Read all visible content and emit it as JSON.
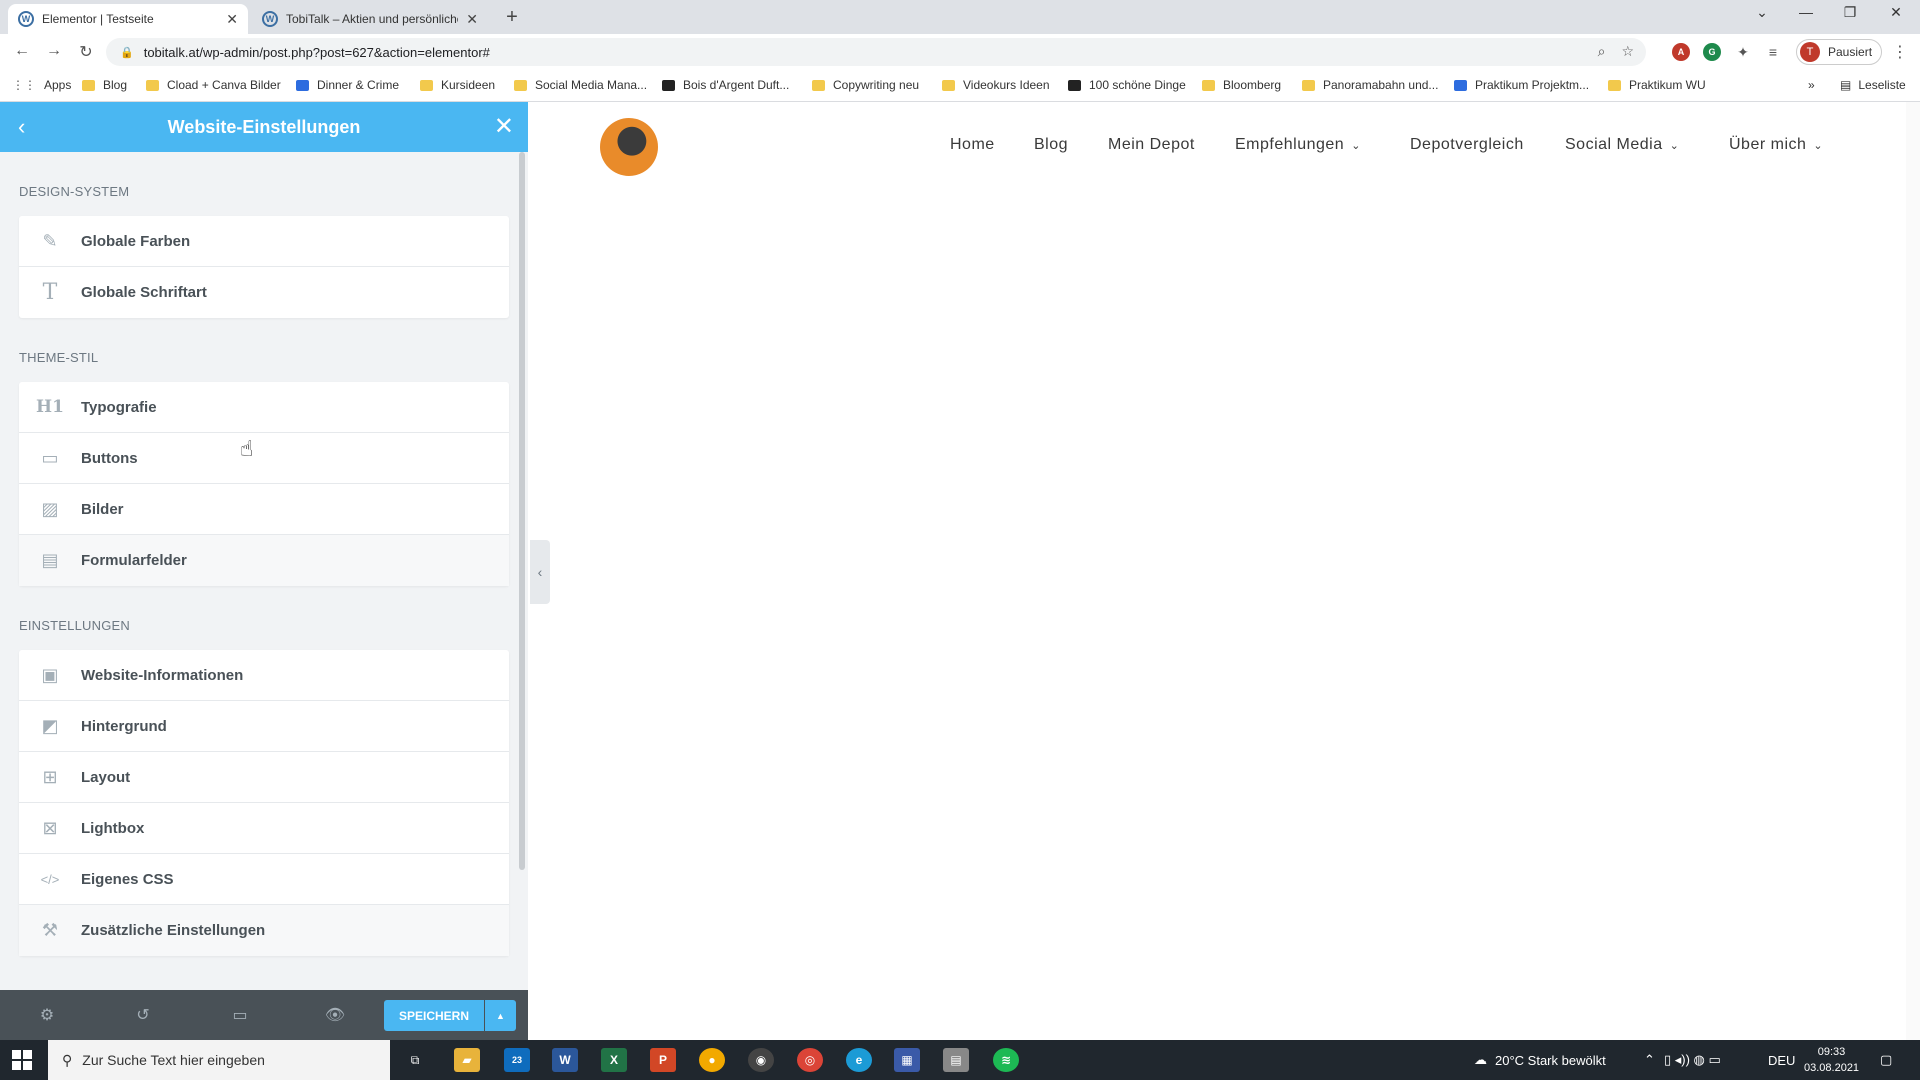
{
  "browser": {
    "tabs": [
      {
        "title": "Elementor | Testseite",
        "active": true
      },
      {
        "title": "TobiTalk – Aktien und persönliche"
      }
    ],
    "url": "tobitalk.at/wp-admin/post.php?post=627&action=elementor#",
    "profile_label": "Pausiert",
    "profile_initial": "T",
    "bookmarks": [
      "Apps",
      "Blog",
      "Cload + Canva Bilder",
      "Dinner & Crime",
      "Kursideen",
      "Social Media Mana...",
      "Bois d'Argent Duft...",
      "Copywriting neu",
      "Videokurs Ideen",
      "100 schöne Dinge",
      "Bloomberg",
      "Panoramabahn und...",
      "Praktikum Projektm...",
      "Praktikum WU"
    ],
    "reading_list": "Leseliste"
  },
  "panel": {
    "title": "Website-Einstellungen",
    "sections": [
      {
        "title": "DESIGN-SYSTEM",
        "items": [
          {
            "label": "Globale Farben",
            "icon": "brush-icon"
          },
          {
            "label": "Globale Schriftart",
            "icon": "text-icon"
          }
        ]
      },
      {
        "title": "THEME-STIL",
        "items": [
          {
            "label": "Typografie",
            "icon": "heading-icon"
          },
          {
            "label": "Buttons",
            "icon": "button-icon"
          },
          {
            "label": "Bilder",
            "icon": "image-icon"
          },
          {
            "label": "Formularfelder",
            "icon": "form-icon"
          }
        ]
      },
      {
        "title": "EINSTELLUNGEN",
        "items": [
          {
            "label": "Website-Informationen",
            "icon": "site-info-icon"
          },
          {
            "label": "Hintergrund",
            "icon": "background-icon"
          },
          {
            "label": "Layout",
            "icon": "layout-icon"
          },
          {
            "label": "Lightbox",
            "icon": "lightbox-icon"
          },
          {
            "label": "Eigenes CSS",
            "icon": "code-icon"
          },
          {
            "label": "Zusätzliche Einstellungen",
            "icon": "tools-icon"
          }
        ]
      }
    ],
    "save_label": "SPEICHERN"
  },
  "site_nav": [
    "Home",
    "Blog",
    "Mein Depot",
    "Empfehlungen",
    "Depotvergleich",
    "Social Media",
    "Über mich"
  ],
  "taskbar": {
    "search_placeholder": "Zur Suche Text hier eingeben",
    "mail_badge": "23",
    "weather": "20°C  Stark bewölkt",
    "language": "DEU",
    "time": "09:33",
    "date": "03.08.2021"
  },
  "colors": {
    "elementor_blue": "#4ab7f2",
    "footer_dark": "#495157",
    "taskbar": "#20272e"
  }
}
